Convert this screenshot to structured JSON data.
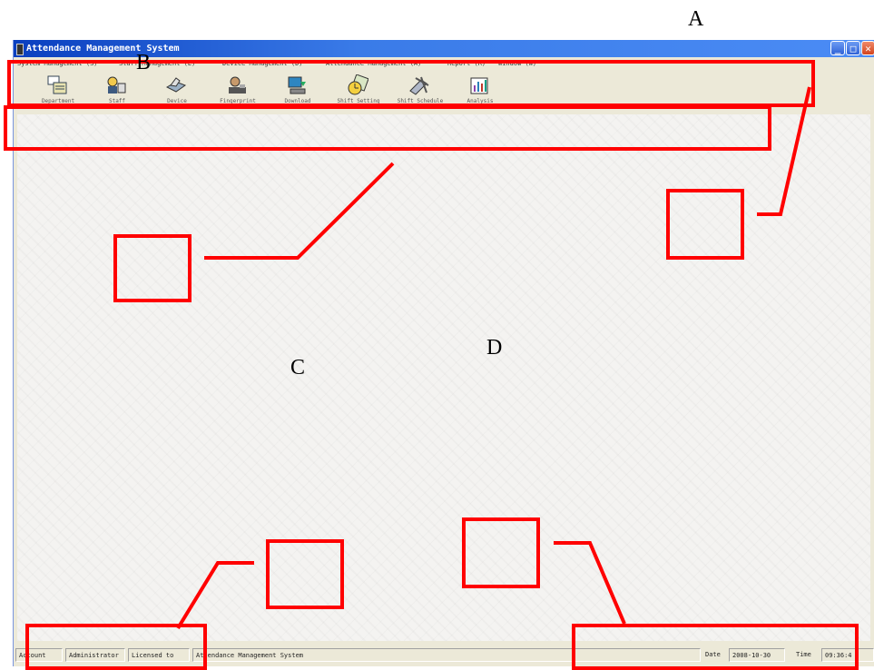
{
  "window": {
    "title": "Attendance Management System",
    "minimize_label": "_",
    "maximize_label": "□",
    "close_label": "✕"
  },
  "menu": [
    "System Management (S)",
    "Staff Management (E)",
    "Device Management (D)",
    "Attendance Management (A)",
    "Report (R)",
    "Window (W)"
  ],
  "toolbar": [
    {
      "label": "Department",
      "icon": "department-icon"
    },
    {
      "label": "Staff",
      "icon": "staff-icon"
    },
    {
      "label": "Device",
      "icon": "device-icon"
    },
    {
      "label": "Fingerprint",
      "icon": "fingerprint-icon"
    },
    {
      "label": "Download",
      "icon": "download-icon"
    },
    {
      "label": "Shift Setting",
      "icon": "shift-setting-icon"
    },
    {
      "label": "Shift Schedule",
      "icon": "shift-schedule-icon"
    },
    {
      "label": "Analysis",
      "icon": "analysis-icon"
    }
  ],
  "status": {
    "account_label": "Account",
    "account_value": "Administrator",
    "licensed_label": "Licensed to",
    "licensed_value": "Attendance Management System",
    "date_label": "Date",
    "date_value": "2008-10-30",
    "time_label": "Time",
    "time_value": "09:36:4"
  },
  "annotations": {
    "a": "A",
    "b": "B",
    "c": "C",
    "d": "D"
  },
  "colors": {
    "annotation": "#ff0000",
    "titlebar": "#0a3fbf"
  }
}
